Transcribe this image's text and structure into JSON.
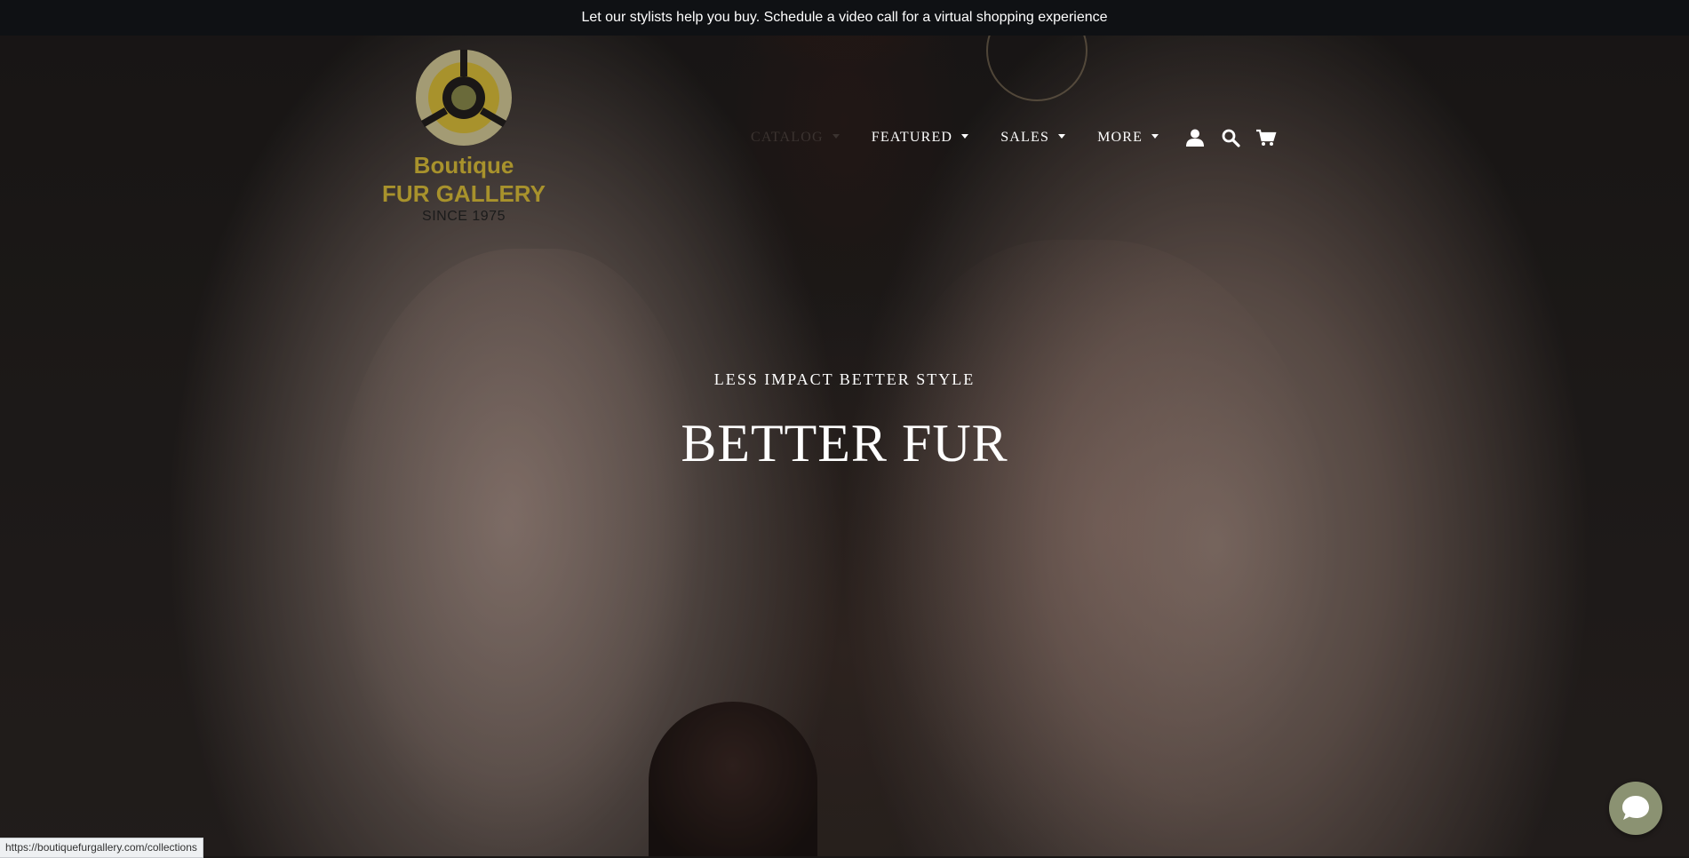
{
  "announcement": {
    "text": "Let our stylists help you buy. Schedule a video call for a virtual shopping experience"
  },
  "logo": {
    "line1": "Boutique",
    "line2": "FUR GALLERY",
    "since": "SINCE 1975",
    "gold": "#a8922c",
    "gold_light": "#a39b74"
  },
  "nav": {
    "items": [
      {
        "label": "CATALOG",
        "dimmed": true
      },
      {
        "label": "FEATURED"
      },
      {
        "label": "SALES"
      },
      {
        "label": "MORE"
      }
    ],
    "icons": [
      "account-icon",
      "search-icon",
      "cart-icon"
    ]
  },
  "hero": {
    "kicker": "LESS IMPACT BETTER STYLE",
    "headline": "BETTER FUR"
  },
  "status_bar": {
    "url": "https://boutiquefurgallery.com/collections"
  },
  "chat": {
    "icon": "chat-bubble-icon",
    "color": "#8b9272"
  }
}
